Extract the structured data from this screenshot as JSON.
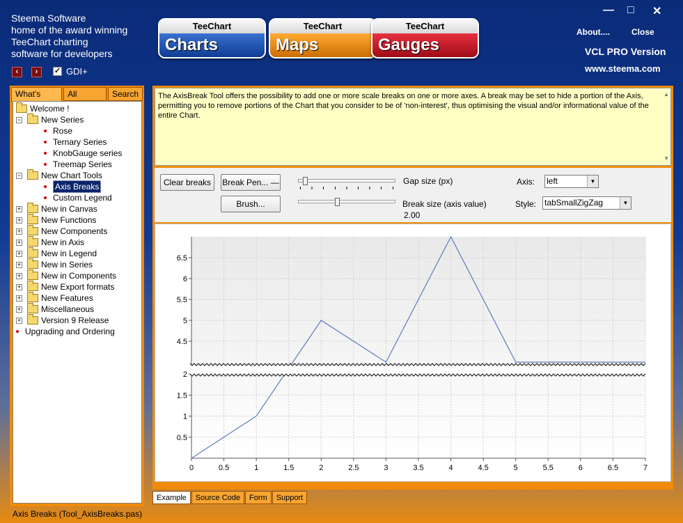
{
  "header": {
    "lines": [
      "Steema Software",
      "home of the award winning",
      "TeeChart charting",
      "software for developers"
    ],
    "gdi_label": "GDI+",
    "about": "About....",
    "close": "Close",
    "version": "VCL PRO Version",
    "website": "www.steema.com",
    "logos": [
      {
        "top": "TeeChart",
        "bottom": "Charts",
        "color": "#1a50b0"
      },
      {
        "top": "TeeChart",
        "bottom": "Maps",
        "color": "#e8830c"
      },
      {
        "top": "TeeChart",
        "bottom": "Gauges",
        "color": "#c0141e"
      }
    ]
  },
  "left_tabs": [
    "What's New ?",
    "All features",
    "Search"
  ],
  "tree": [
    {
      "label": "Welcome !",
      "kind": "folder-open",
      "level": 0
    },
    {
      "label": "New Series",
      "kind": "folder-open",
      "level": 1
    },
    {
      "label": "Rose",
      "kind": "leaf",
      "level": 2
    },
    {
      "label": "Ternary Series",
      "kind": "leaf",
      "level": 2
    },
    {
      "label": "KnobGauge series",
      "kind": "leaf",
      "level": 2
    },
    {
      "label": "Treemap Series",
      "kind": "leaf",
      "level": 2
    },
    {
      "label": "New Chart Tools",
      "kind": "folder-open",
      "level": 1
    },
    {
      "label": "Axis Breaks",
      "kind": "leaf-selected",
      "level": 2
    },
    {
      "label": "Custom Legend",
      "kind": "leaf",
      "level": 2
    },
    {
      "label": "New in Canvas",
      "kind": "folder",
      "level": 1
    },
    {
      "label": "New Functions",
      "kind": "folder",
      "level": 1
    },
    {
      "label": "New Components",
      "kind": "folder",
      "level": 1
    },
    {
      "label": "New in Axis",
      "kind": "folder",
      "level": 1
    },
    {
      "label": "New in Legend",
      "kind": "folder",
      "level": 1
    },
    {
      "label": "New in Series",
      "kind": "folder",
      "level": 1
    },
    {
      "label": "New in Components",
      "kind": "folder",
      "level": 1
    },
    {
      "label": "New Export formats",
      "kind": "folder",
      "level": 1
    },
    {
      "label": "New Features",
      "kind": "folder",
      "level": 1
    },
    {
      "label": "Miscellaneous",
      "kind": "folder",
      "level": 1
    },
    {
      "label": "Version 9 Release",
      "kind": "folder",
      "level": 1
    },
    {
      "label": "Upgrading and Ordering",
      "kind": "leaf-root",
      "level": 0
    }
  ],
  "description": "The AxisBreak Tool offers the possibility to add one or more scale breaks on one or more axes. A break may be set to hide a portion of the Axis, permitting you to remove portions of the Chart that you consider to be of 'non-interest', thus optimising the visual and/or informational value of the entire Chart.",
  "controls": {
    "clear_breaks": "Clear breaks",
    "break_pen": "Break Pen...",
    "brush": "Brush...",
    "gap_size_label": "Gap size (px)",
    "break_size_label": "Break size (axis value)",
    "break_size_value": "2.00",
    "axis_label": "Axis:",
    "axis_value": "left",
    "style_label": "Style:",
    "style_value": "tabSmallZigZag",
    "gap_slider": 0.05,
    "break_slider": 0.4
  },
  "bottom_tabs": [
    "Example",
    "Source Code",
    "Form",
    "Support"
  ],
  "status": "Axis Breaks (Tool_AxisBreaks.pas)",
  "chart_data": {
    "type": "line",
    "x": [
      0,
      1,
      2,
      3,
      4,
      5,
      6,
      7
    ],
    "values": [
      0,
      1,
      5,
      4,
      7,
      4,
      4,
      4
    ],
    "x_ticks": [
      "0",
      "0.5",
      "1",
      "1.5",
      "2",
      "2.5",
      "3",
      "3.5",
      "4",
      "4.5",
      "5",
      "5.5",
      "6",
      "6.5",
      "7"
    ],
    "y_ticks_lower": [
      "0.5",
      "1",
      "1.5",
      "2"
    ],
    "y_ticks_upper": [
      "4.5",
      "5",
      "5.5",
      "6",
      "6.5"
    ],
    "axis_break": [
      2,
      4
    ],
    "line_color": "#5b7bbf",
    "grid": true
  }
}
